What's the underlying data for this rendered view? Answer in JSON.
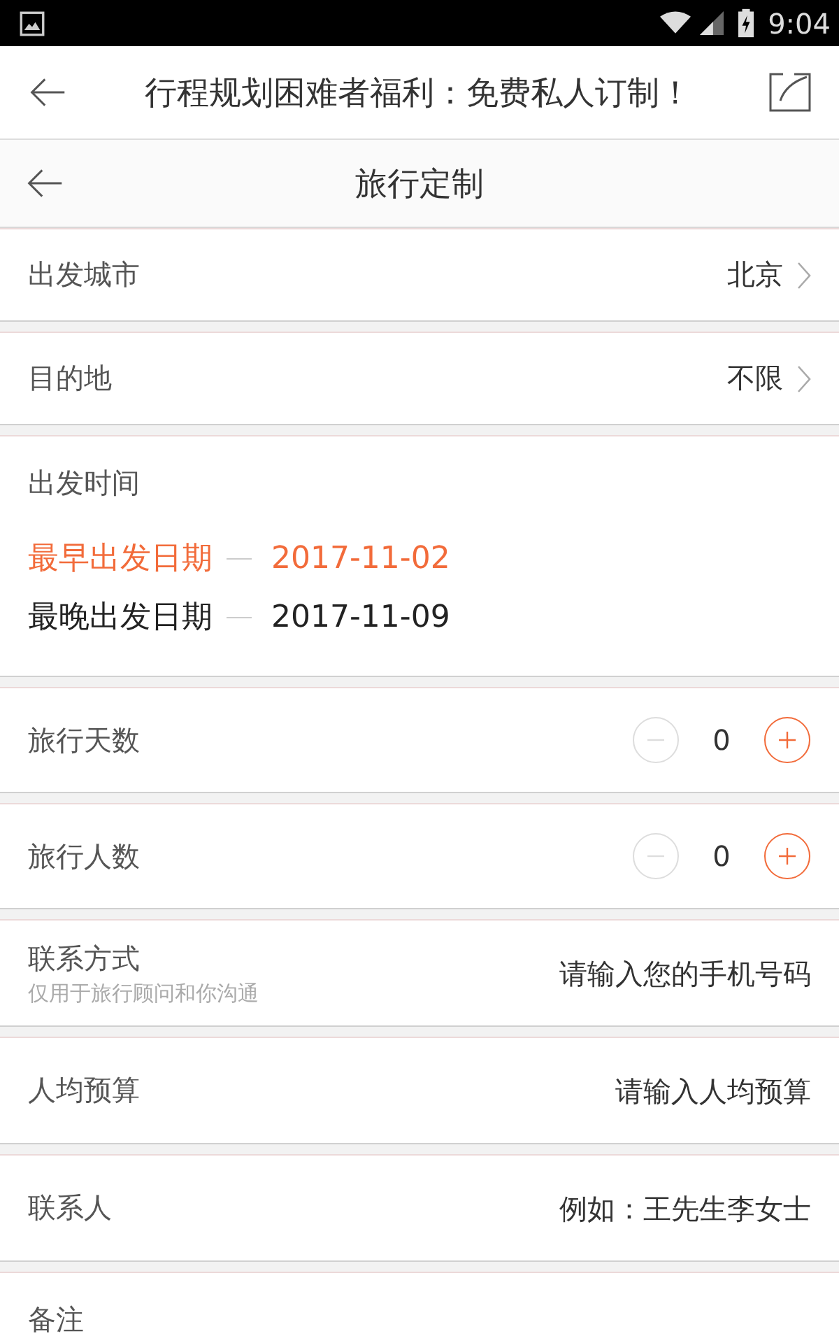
{
  "status_bar": {
    "time": "9:04"
  },
  "app_bar": {
    "title": "行程规划困难者福利：免费私人订制！"
  },
  "page_header": {
    "title": "旅行定制"
  },
  "rows": [
    {
      "kind": "select",
      "label": "出发城市",
      "value": "北京"
    },
    {
      "kind": "select",
      "label": "目的地",
      "value": "不限"
    },
    {
      "kind": "dates",
      "label": "出发时间",
      "dates": [
        {
          "label": "最早出发日期",
          "value": "2017-11-02",
          "selected": true
        },
        {
          "label": "最晚出发日期",
          "value": "2017-11-09",
          "selected": false
        }
      ]
    },
    {
      "kind": "counter",
      "label": "旅行天数",
      "count": "0",
      "can_decrease": false
    },
    {
      "kind": "counter",
      "label": "旅行人数",
      "count": "0",
      "can_decrease": false
    },
    {
      "kind": "input",
      "label": "联系方式",
      "hint": "仅用于旅行顾问和你沟通",
      "placeholder": "请输入您的手机号码"
    },
    {
      "kind": "input",
      "label": "人均预算",
      "placeholder": "请输入人均预算"
    },
    {
      "kind": "input",
      "label": "联系人",
      "placeholder": "例如：王先生李女士"
    },
    {
      "kind": "note",
      "label": "备注"
    }
  ]
}
